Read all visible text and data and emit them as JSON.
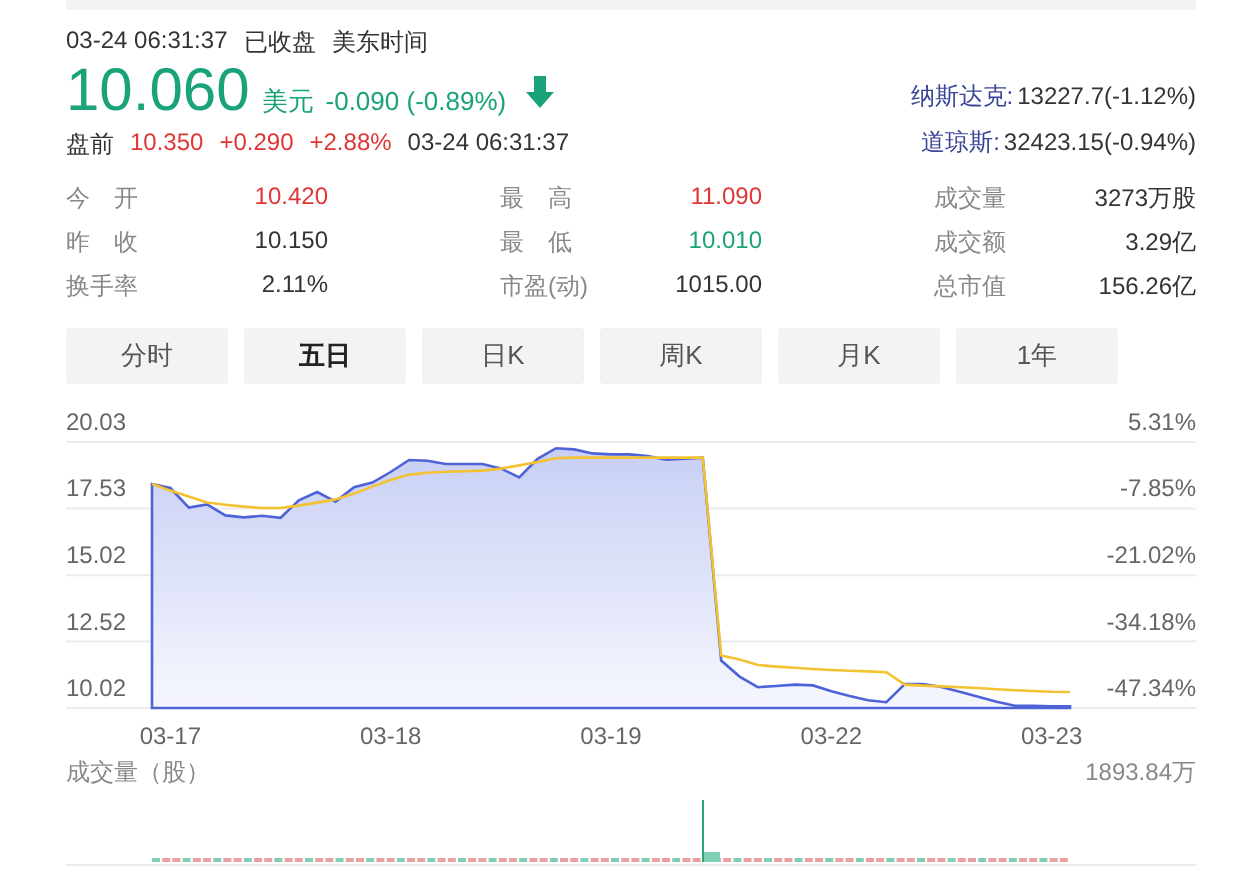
{
  "header": {
    "datetime": "03-24 06:31:37",
    "status": "已收盘",
    "timezone": "美东时间"
  },
  "quote": {
    "price": "10.060",
    "currency": "美元",
    "change": "-0.090 (-0.89%)",
    "color": "#1aa37b"
  },
  "premarket": {
    "label": "盘前",
    "price": "10.350",
    "change": "+0.290",
    "percent": "+2.88%",
    "color": "#e03535",
    "time": "03-24 06:31:37"
  },
  "indices": [
    {
      "name": "纳斯达克:",
      "value": "13227.7(-1.12%)"
    },
    {
      "name": "道琼斯:",
      "value": "32423.15(-0.94%)"
    }
  ],
  "stats": [
    [
      {
        "label": "今　开",
        "value": "10.420",
        "color": "#e03535"
      },
      {
        "label": "昨　收",
        "value": "10.150",
        "color": "#333333"
      },
      {
        "label": "换手率",
        "value": "2.11%",
        "color": "#333333"
      }
    ],
    [
      {
        "label": "最　高",
        "value": "11.090",
        "color": "#e03535"
      },
      {
        "label": "最　低",
        "value": "10.010",
        "color": "#1aa37b"
      },
      {
        "label": "市盈(动)",
        "value": "1015.00",
        "color": "#333333"
      }
    ],
    [
      {
        "label": "成交量",
        "value": "3273万股",
        "color": "#333333"
      },
      {
        "label": "成交额",
        "value": "3.29亿",
        "color": "#333333"
      },
      {
        "label": "总市值",
        "value": "156.26亿",
        "color": "#333333"
      }
    ]
  ],
  "tabs": [
    {
      "label": "分时",
      "selected": false
    },
    {
      "label": "五日",
      "selected": true
    },
    {
      "label": "日K",
      "selected": false
    },
    {
      "label": "周K",
      "selected": false
    },
    {
      "label": "月K",
      "selected": false
    },
    {
      "label": "1年",
      "selected": false
    }
  ],
  "price_chart": {
    "percent_labels": [
      "5.31%",
      "-7.85%",
      "-21.02%",
      "-34.18%",
      "-47.34%"
    ],
    "chart_data": {
      "type": "line",
      "categories": [
        null,
        "03-17",
        null,
        null,
        null,
        null,
        null,
        null,
        null,
        null,
        null,
        null,
        null,
        "03-18",
        null,
        null,
        null,
        null,
        null,
        null,
        null,
        null,
        null,
        null,
        null,
        "03-19",
        null,
        null,
        null,
        null,
        null,
        null,
        null,
        null,
        null,
        null,
        null,
        "03-22",
        null,
        null,
        null,
        null,
        null,
        null,
        null,
        null,
        null,
        null,
        null,
        "03-23",
        null
      ],
      "series": [
        {
          "type": "area",
          "color": "#4f63d8",
          "values": [
            18.45,
            18.3,
            17.56,
            17.68,
            17.27,
            17.19,
            17.25,
            17.18,
            17.83,
            18.15,
            17.79,
            18.33,
            18.5,
            18.9,
            19.35,
            19.32,
            19.2,
            19.2,
            19.2,
            19.04,
            18.7,
            19.4,
            19.8,
            19.75,
            19.6,
            19.56,
            19.56,
            19.5,
            19.36,
            19.4,
            19.44,
            11.8,
            11.2,
            10.8,
            10.85,
            10.9,
            10.87,
            10.65,
            10.47,
            10.31,
            10.24,
            10.92,
            10.92,
            10.81,
            10.63,
            10.44,
            10.25,
            10.1,
            10.1,
            10.09,
            10.08
          ]
        },
        {
          "type": "line",
          "color": "#f2c230",
          "values": [
            18.45,
            18.2,
            17.98,
            17.75,
            17.67,
            17.6,
            17.55,
            17.55,
            17.64,
            17.75,
            17.87,
            18.09,
            18.35,
            18.6,
            18.8,
            18.87,
            18.91,
            18.93,
            18.95,
            19.03,
            19.15,
            19.28,
            19.42,
            19.44,
            19.44,
            19.44,
            19.44,
            19.44,
            19.44,
            19.44,
            19.44,
            12.0,
            11.84,
            11.64,
            11.58,
            11.53,
            11.49,
            11.45,
            11.42,
            11.4,
            11.37,
            10.9,
            10.86,
            10.83,
            10.8,
            10.77,
            10.73,
            10.69,
            10.66,
            10.63,
            10.62
          ]
        }
      ],
      "grid": true,
      "ylim": [
        10.02,
        20.03
      ],
      "yticks": [
        {
          "value": 20.03,
          "label": "20.03"
        },
        {
          "value": 17.53,
          "label": "17.53"
        },
        {
          "value": 15.02,
          "label": "15.02"
        },
        {
          "value": 12.52,
          "label": "12.52"
        },
        {
          "value": 10.02,
          "label": "10.02"
        }
      ]
    }
  },
  "volume": {
    "title": "成交量（股）",
    "max": "1893.84万"
  }
}
